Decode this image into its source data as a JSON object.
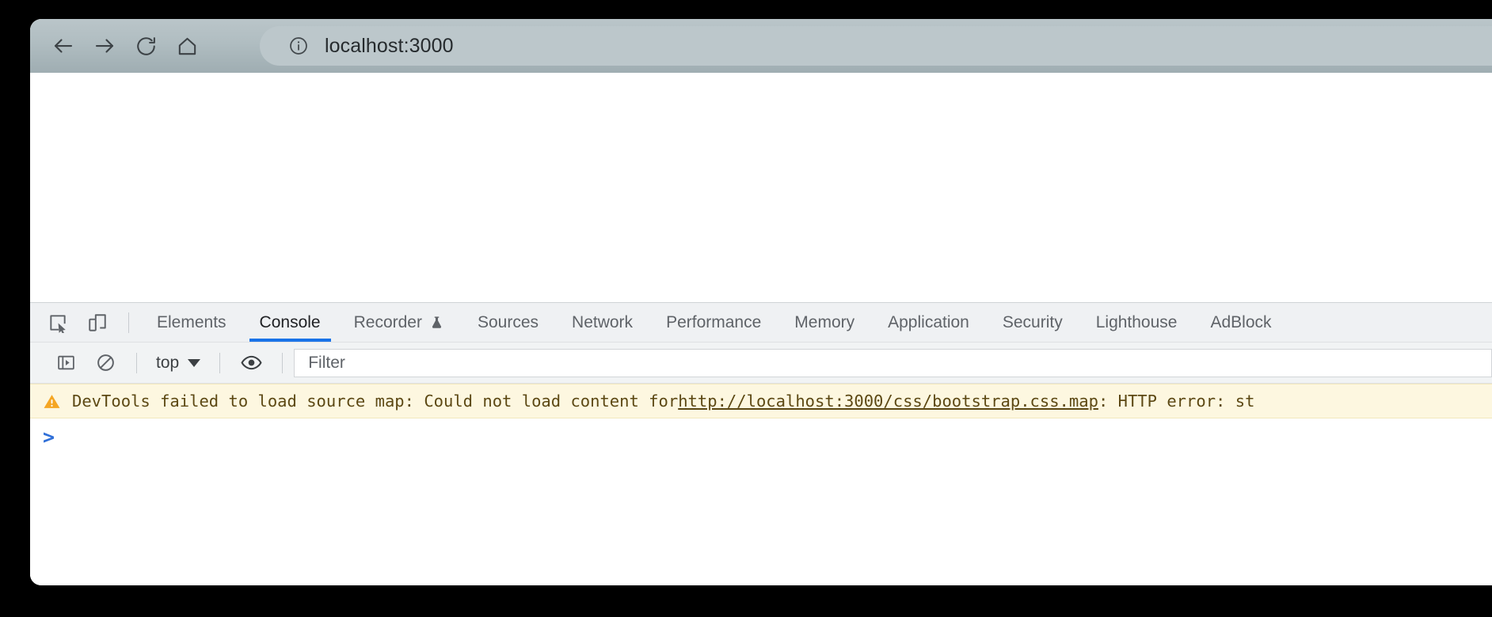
{
  "browser": {
    "nav": [
      {
        "name": "back-button",
        "icon": "arrow-left-icon"
      },
      {
        "name": "forward-button",
        "icon": "arrow-right-icon"
      },
      {
        "name": "reload-button",
        "icon": "reload-icon"
      },
      {
        "name": "home-button",
        "icon": "home-icon"
      }
    ],
    "address_bar": {
      "icon": "info-circle-icon",
      "value": "localhost:3000"
    }
  },
  "devtools": {
    "toolbar_icons": [
      {
        "name": "inspect-element-icon",
        "label": "inspect-element"
      },
      {
        "name": "device-toolbar-icon",
        "label": "device-toolbar"
      }
    ],
    "tabs": [
      {
        "label": "Elements",
        "active": false,
        "icon": null
      },
      {
        "label": "Console",
        "active": true,
        "icon": null
      },
      {
        "label": "Recorder",
        "active": false,
        "icon": "flask-icon"
      },
      {
        "label": "Sources",
        "active": false,
        "icon": null
      },
      {
        "label": "Network",
        "active": false,
        "icon": null
      },
      {
        "label": "Performance",
        "active": false,
        "icon": null
      },
      {
        "label": "Memory",
        "active": false,
        "icon": null
      },
      {
        "label": "Application",
        "active": false,
        "icon": null
      },
      {
        "label": "Security",
        "active": false,
        "icon": null
      },
      {
        "label": "Lighthouse",
        "active": false,
        "icon": null
      },
      {
        "label": "AdBlock",
        "active": false,
        "icon": null
      }
    ],
    "console_toolbar": {
      "sidebar_toggle_icon": "console-sidebar-icon",
      "clear_console_icon": "clear-console-icon",
      "context": "top",
      "context_caret_icon": "chevron-down-icon",
      "live_expression_icon": "eye-icon",
      "filter_placeholder": "Filter"
    },
    "console_messages": [
      {
        "level": "warning",
        "icon": "warning-triangle-icon",
        "text_before": "DevTools failed to load source map: Could not load content for ",
        "link": "http://localhost:3000/css/bootstrap.css.map",
        "text_after": ": HTTP error: st"
      }
    ],
    "prompt": ">"
  },
  "colors": {
    "accent": "#1a73e8",
    "warning_bg": "#fdf7e0",
    "warning_border": "#f2e8bd",
    "warning_text": "#5c4813",
    "warning_icon": "#f5a623",
    "toolbar_bg": "#b0bdc1",
    "devtools_bg": "#eff1f3",
    "prompt": "#2f6fd8"
  }
}
